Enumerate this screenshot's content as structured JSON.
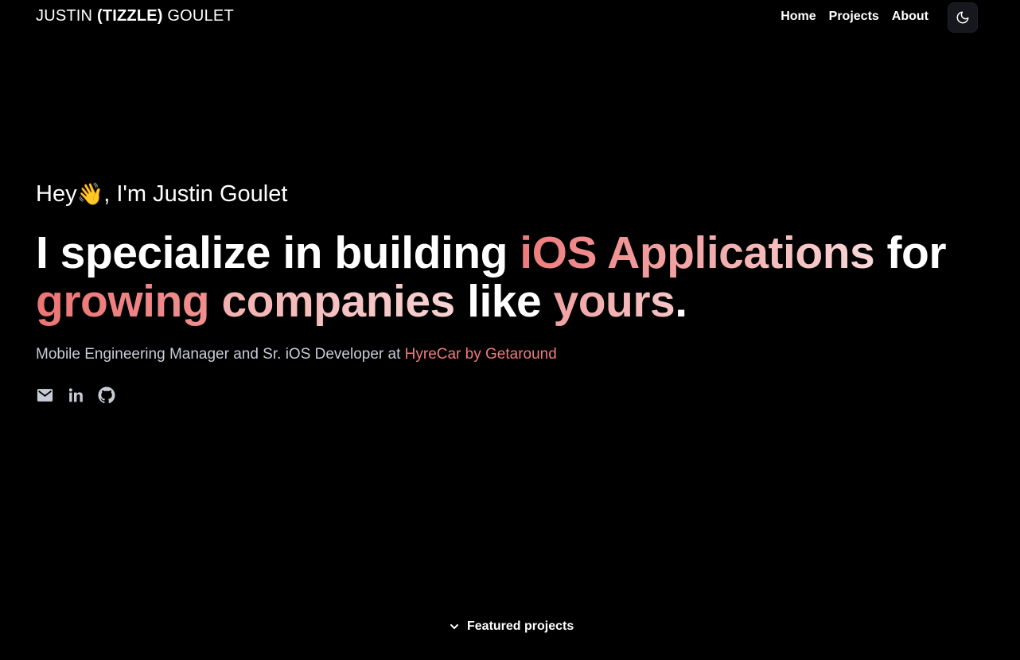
{
  "header": {
    "brand_first": "JUSTIN",
    "brand_middle": "(TIZZLE)",
    "brand_last": "GOULET",
    "nav": [
      {
        "label": "Home"
      },
      {
        "label": "Projects"
      },
      {
        "label": "About"
      }
    ],
    "theme_toggle_icon": "moon-icon"
  },
  "hero": {
    "greeting_before": "Hey",
    "greeting_emoji": "👋",
    "greeting_after": ", I'm Justin Goulet",
    "headline": {
      "part1": "I specialize in building ",
      "highlight1": "iOS Applications",
      "part2": " for ",
      "highlight2": "growing",
      "part3": " ",
      "highlight3": "companies",
      "part4": " like ",
      "highlight4": "yours",
      "part5": "."
    },
    "subtitle_text": "Mobile Engineering Manager and Sr. iOS Developer at ",
    "subtitle_company": "HyreCar by Getaround",
    "socials": [
      "mail-icon",
      "linkedin-icon",
      "github-icon"
    ]
  },
  "featured": {
    "label": "Featured projects",
    "icon": "chevron-down-icon"
  },
  "colors": {
    "background": "#000000",
    "accent": "#f07a7a",
    "muted_text": "#c7ccd6"
  }
}
